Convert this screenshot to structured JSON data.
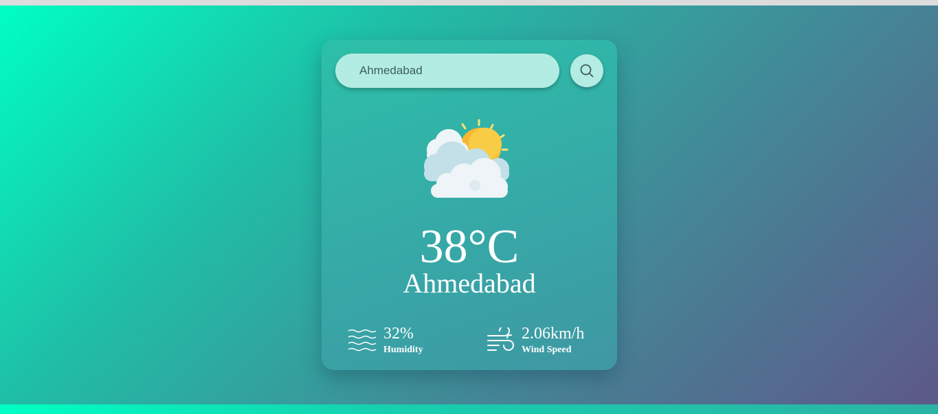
{
  "search": {
    "value": "Ahmedabad",
    "placeholder": ""
  },
  "search_button": {
    "icon": "search-icon"
  },
  "weather": {
    "icon": "partly-cloudy-icon",
    "temperature": "38°C",
    "city": "Ahmedabad"
  },
  "humidity": {
    "icon": "humidity-waves-icon",
    "value": "32%",
    "label": "Humidity"
  },
  "wind": {
    "icon": "wind-icon",
    "value": "2.06km/h",
    "label": "Wind Speed"
  },
  "colors": {
    "background_start": "#00ffc3",
    "background_end": "#5e5889",
    "card": "#36a9a7",
    "input": "#b3ece3",
    "sun": "#f7b733",
    "text": "#ffffff"
  }
}
